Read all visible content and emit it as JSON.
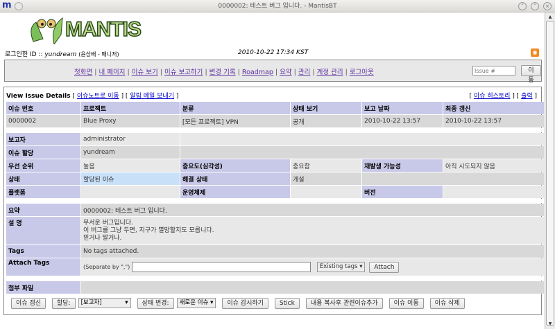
{
  "window": {
    "title": "0000002: 테스트 버그 입니다. - MantisBT",
    "app_icon": "m"
  },
  "logo": {
    "text": "MANTIS"
  },
  "login": {
    "label": "로그인한 ID :: ",
    "user": "yundream",
    "role": "(윤상배 - 매니저)",
    "datetime": "2010-10-22 17:34 KST"
  },
  "nav": {
    "links": [
      "첫화면",
      "내 페이지",
      "이슈 보기",
      "이슈 보고하기",
      "변경 기록",
      "Roadmap",
      "요약",
      "관리",
      "계정 관리",
      "로그아웃"
    ],
    "issue_placeholder": "Issue #",
    "go_label": "이동"
  },
  "details": {
    "title": "View Issue Details",
    "link_notes": "이슈노트로 이동",
    "link_mail": "알림 메일 보내기",
    "link_history": "이슈 히스토리",
    "link_print": "출력"
  },
  "issue": {
    "headers": [
      "이슈 번호",
      "프로젝트",
      "분류",
      "상태 보기",
      "보고 날짜",
      "최종 갱신"
    ],
    "values": [
      "0000002",
      "Blue Proxy",
      "[모든 프로젝트] VPN",
      "공개",
      "2010-10-22 13:57",
      "2010-10-22 13:57"
    ],
    "reporter_label": "보고자",
    "reporter": "administrator",
    "assigned_label": "이슈 할당",
    "assigned": "yundream",
    "priority_label": "우선 순위",
    "priority": "높음",
    "severity_label": "중요도(심각성)",
    "severity": "중요함",
    "repro_label": "재발생 가능성",
    "repro": "아직 시도되지 않음",
    "status_label": "상태",
    "status": "할당된 이슈",
    "resolution_label": "해결 상태",
    "resolution": "개설",
    "platform_label": "플랫폼",
    "os_label": "운영체제",
    "version_label": "버전",
    "summary_label": "요약",
    "summary": "0000002: 테스트 버그 입니다.",
    "desc_label": "설 명",
    "desc": [
      "무서운 버그입니다.",
      "이 버그를 그냥 두면, 지구가 멸망할지도 모릅니다.",
      "믿거나 말거나."
    ],
    "tags_label": "Tags",
    "tags": "No tags attached.",
    "attach_tags_label": "Attach Tags",
    "separate_hint": "(Separate by \",\")",
    "existing_tags": "Existing tags",
    "attach_button": "Attach",
    "files_label": "첨부 파일"
  },
  "actions": {
    "update": "이슈 갱신",
    "assign": "할당:",
    "assign_value": "[보고자]",
    "change_status": "상태 변경:",
    "status_value": "새로운 이슈",
    "monitor": "이슈 감시하기",
    "stick": "Stick",
    "clone": "내용 복사후 관련이슈추가",
    "move": "이슈 이동",
    "delete": "이슈 삭제"
  }
}
